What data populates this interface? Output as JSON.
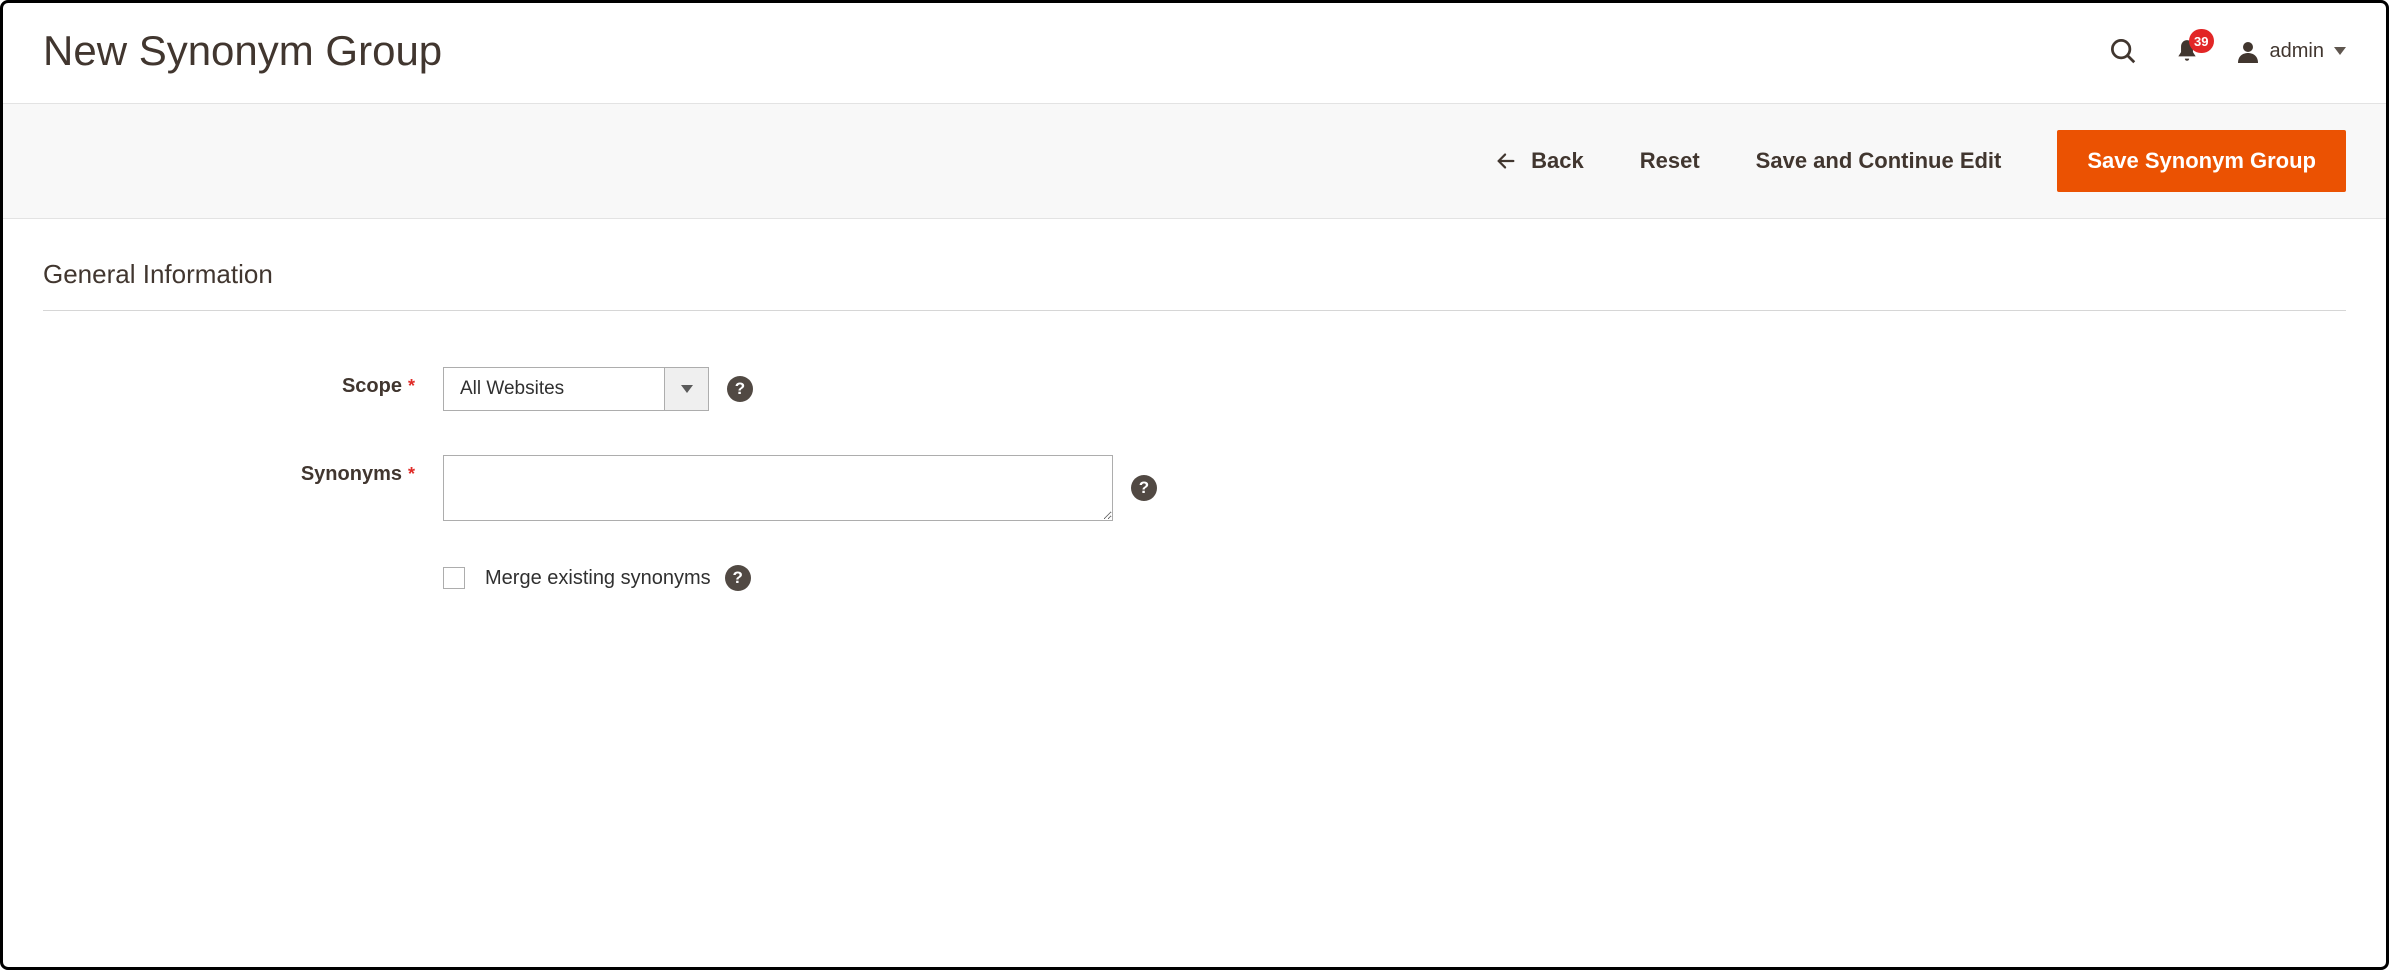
{
  "header": {
    "title": "New Synonym Group",
    "user": "admin",
    "notification_count": "39"
  },
  "actions": {
    "back": "Back",
    "reset": "Reset",
    "save_continue": "Save and Continue Edit",
    "save": "Save Synonym Group"
  },
  "section": {
    "title": "General Information"
  },
  "form": {
    "scope": {
      "label": "Scope",
      "value": "All Websites"
    },
    "synonyms": {
      "label": "Synonyms",
      "value": ""
    },
    "merge": {
      "label": "Merge existing synonyms",
      "checked": false
    }
  }
}
